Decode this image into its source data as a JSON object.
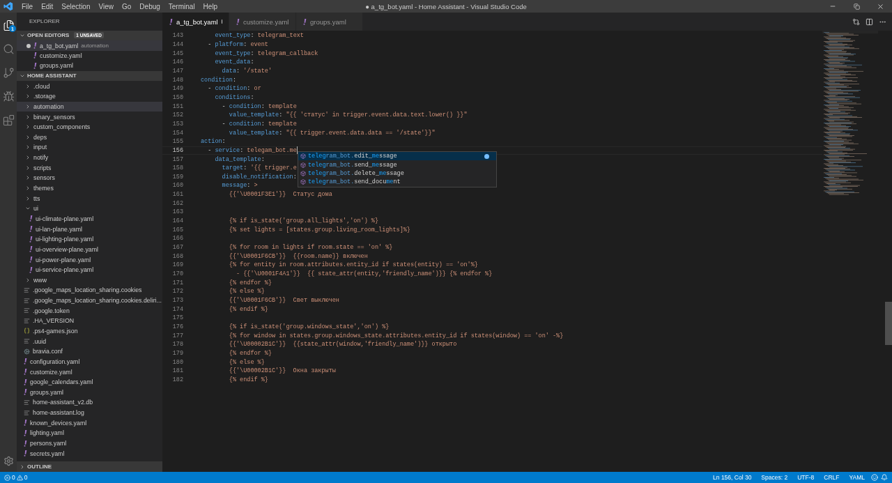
{
  "menu": [
    "File",
    "Edit",
    "Selection",
    "View",
    "Go",
    "Debug",
    "Terminal",
    "Help"
  ],
  "window": {
    "title": "● a_tg_bot.yaml - Home Assistant - Visual Studio Code"
  },
  "activity": [
    {
      "kind": "files",
      "selected": true,
      "badge": "1"
    },
    {
      "kind": "search",
      "selected": false
    },
    {
      "kind": "git",
      "selected": false
    },
    {
      "kind": "debug",
      "selected": false
    },
    {
      "kind": "extensions",
      "selected": false
    }
  ],
  "explorer": {
    "title": "EXPLORER",
    "open_editors": {
      "title": "OPEN EDITORS",
      "badge": "1 UNSAVED",
      "expanded": true,
      "items": [
        {
          "name": "a_tg_bot.yaml",
          "hint": "automation",
          "dirty": true,
          "selected": true
        },
        {
          "name": "customize.yaml",
          "dirty": false,
          "selected": false
        },
        {
          "name": "groups.yaml",
          "dirty": false,
          "selected": false
        }
      ]
    },
    "folder": {
      "title": "HOME ASSISTANT",
      "expanded": true,
      "items": [
        {
          "name": ".cloud",
          "kind": "folder",
          "expanded": false,
          "selected": false
        },
        {
          "name": ".storage",
          "kind": "folder",
          "expanded": false,
          "selected": false
        },
        {
          "name": "automation",
          "kind": "folder",
          "expanded": false,
          "selected": true
        },
        {
          "name": "binary_sensors",
          "kind": "folder",
          "expanded": false,
          "selected": false
        },
        {
          "name": "custom_components",
          "kind": "folder",
          "expanded": false,
          "selected": false
        },
        {
          "name": "deps",
          "kind": "folder",
          "expanded": false,
          "selected": false
        },
        {
          "name": "input",
          "kind": "folder",
          "expanded": false,
          "selected": false
        },
        {
          "name": "notify",
          "kind": "folder",
          "expanded": false,
          "selected": false
        },
        {
          "name": "scripts",
          "kind": "folder",
          "expanded": false,
          "selected": false
        },
        {
          "name": "sensors",
          "kind": "folder",
          "expanded": false,
          "selected": false
        },
        {
          "name": "themes",
          "kind": "folder",
          "expanded": false,
          "selected": false
        },
        {
          "name": "tts",
          "kind": "folder",
          "expanded": false,
          "selected": false
        },
        {
          "name": "ui",
          "kind": "folder",
          "expanded": true,
          "selected": false,
          "children": [
            {
              "name": "ui-climate-plane.yaml",
              "kind": "yaml",
              "selected": false
            },
            {
              "name": "ui-lan-plane.yaml",
              "kind": "yaml",
              "selected": false
            },
            {
              "name": "ui-lighting-plane.yaml",
              "kind": "yaml",
              "selected": false
            },
            {
              "name": "ui-overview-plane.yaml",
              "kind": "yaml",
              "selected": false
            },
            {
              "name": "ui-power-plane.yaml",
              "kind": "yaml",
              "selected": false
            },
            {
              "name": "ui-service-plane.yaml",
              "kind": "yaml",
              "selected": false
            }
          ]
        },
        {
          "name": "www",
          "kind": "folder",
          "expanded": false,
          "selected": false
        },
        {
          "name": ".google_maps_location_sharing.cookies",
          "kind": "file",
          "selected": false
        },
        {
          "name": ".google_maps_location_sharing.cookies.deliri...",
          "kind": "file",
          "selected": false
        },
        {
          "name": ".google.token",
          "kind": "file",
          "selected": false
        },
        {
          "name": ".HA_VERSION",
          "kind": "file",
          "selected": false
        },
        {
          "name": ".ps4-games.json",
          "kind": "json",
          "selected": false
        },
        {
          "name": ".uuid",
          "kind": "file",
          "selected": false
        },
        {
          "name": "bravia.conf",
          "kind": "config",
          "selected": false
        },
        {
          "name": "configuration.yaml",
          "kind": "yaml",
          "selected": false
        },
        {
          "name": "customize.yaml",
          "kind": "yaml",
          "selected": false
        },
        {
          "name": "google_calendars.yaml",
          "kind": "yaml",
          "selected": false
        },
        {
          "name": "groups.yaml",
          "kind": "yaml",
          "selected": false
        },
        {
          "name": "home-assistant_v2.db",
          "kind": "file",
          "selected": false
        },
        {
          "name": "home-assistant.log",
          "kind": "file",
          "selected": false
        },
        {
          "name": "known_devices.yaml",
          "kind": "yaml",
          "selected": false
        },
        {
          "name": "lighting.yaml",
          "kind": "yaml",
          "selected": false
        },
        {
          "name": "persons.yaml",
          "kind": "yaml",
          "selected": false
        },
        {
          "name": "secrets.yaml",
          "kind": "yaml",
          "selected": false
        }
      ]
    },
    "outline": {
      "title": "OUTLINE",
      "expanded": false
    }
  },
  "tabs": [
    {
      "label": "a_tg_bot.yaml",
      "dirty": true,
      "selected": true
    },
    {
      "label": "customize.yaml",
      "selected": false
    },
    {
      "label": "groups.yaml",
      "selected": false
    }
  ],
  "code": [
    {
      "number": "143",
      "active": false,
      "tokens": [
        {
          "kind": "key",
          "text": "    event_type"
        },
        {
          "kind": "punct",
          "text": ": "
        },
        {
          "kind": "value",
          "text": "telegram_text"
        }
      ]
    },
    {
      "number": "144",
      "active": false,
      "tokens": [
        {
          "kind": "punct",
          "text": "  - "
        },
        {
          "kind": "key",
          "text": "platform"
        },
        {
          "kind": "punct",
          "text": ": "
        },
        {
          "kind": "value",
          "text": "event"
        }
      ]
    },
    {
      "number": "145",
      "active": false,
      "tokens": [
        {
          "kind": "key",
          "text": "    event_type"
        },
        {
          "kind": "punct",
          "text": ": "
        },
        {
          "kind": "value",
          "text": "telegram_callback"
        }
      ]
    },
    {
      "number": "146",
      "active": false,
      "tokens": [
        {
          "kind": "key",
          "text": "    event_data"
        },
        {
          "kind": "punct",
          "text": ":"
        }
      ]
    },
    {
      "number": "147",
      "active": false,
      "tokens": [
        {
          "kind": "key",
          "text": "      data"
        },
        {
          "kind": "punct",
          "text": ": "
        },
        {
          "kind": "value",
          "text": "'/state'"
        }
      ]
    },
    {
      "number": "148",
      "active": false,
      "tokens": [
        {
          "kind": "key",
          "text": "condition"
        },
        {
          "kind": "punct",
          "text": ":"
        }
      ]
    },
    {
      "number": "149",
      "active": false,
      "tokens": [
        {
          "kind": "punct",
          "text": "  - "
        },
        {
          "kind": "key",
          "text": "condition"
        },
        {
          "kind": "punct",
          "text": ": "
        },
        {
          "kind": "value",
          "text": "or"
        }
      ]
    },
    {
      "number": "150",
      "active": false,
      "tokens": [
        {
          "kind": "key",
          "text": "    conditions"
        },
        {
          "kind": "punct",
          "text": ":"
        }
      ]
    },
    {
      "number": "151",
      "active": false,
      "tokens": [
        {
          "kind": "punct",
          "text": "      - "
        },
        {
          "kind": "key",
          "text": "condition"
        },
        {
          "kind": "punct",
          "text": ": "
        },
        {
          "kind": "value",
          "text": "template"
        }
      ]
    },
    {
      "number": "152",
      "active": false,
      "tokens": [
        {
          "kind": "key",
          "text": "        value_template"
        },
        {
          "kind": "punct",
          "text": ": "
        },
        {
          "kind": "value",
          "text": "\"{{ 'статус' in trigger.event.data.text.lower() }}\""
        }
      ]
    },
    {
      "number": "153",
      "active": false,
      "tokens": [
        {
          "kind": "punct",
          "text": "      - "
        },
        {
          "kind": "key",
          "text": "condition"
        },
        {
          "kind": "punct",
          "text": ": "
        },
        {
          "kind": "value",
          "text": "template"
        }
      ]
    },
    {
      "number": "154",
      "active": false,
      "tokens": [
        {
          "kind": "key",
          "text": "        value_template"
        },
        {
          "kind": "punct",
          "text": ": "
        },
        {
          "kind": "value",
          "text": "\"{{ trigger.event.data.data == '/state'}}\""
        }
      ]
    },
    {
      "number": "155",
      "active": false,
      "tokens": [
        {
          "kind": "key",
          "text": "action"
        },
        {
          "kind": "punct",
          "text": ":"
        }
      ]
    },
    {
      "number": "156",
      "active": true,
      "tokens": [
        {
          "kind": "punct",
          "text": "  - "
        },
        {
          "kind": "key",
          "text": "service"
        },
        {
          "kind": "punct",
          "text": ": "
        },
        {
          "kind": "value",
          "text": "telegam_bot.me"
        }
      ]
    },
    {
      "number": "157",
      "active": false,
      "tokens": [
        {
          "kind": "key",
          "text": "    data_template"
        },
        {
          "kind": "punct",
          "text": ":"
        }
      ]
    },
    {
      "number": "158",
      "active": false,
      "tokens": [
        {
          "kind": "key",
          "text": "      target"
        },
        {
          "kind": "punct",
          "text": ": "
        },
        {
          "kind": "value",
          "text": "'{{ trigger.e"
        }
      ]
    },
    {
      "number": "159",
      "active": false,
      "tokens": [
        {
          "kind": "key",
          "text": "      disable_notification"
        },
        {
          "kind": "punct",
          "text": ":"
        }
      ]
    },
    {
      "number": "160",
      "active": false,
      "tokens": [
        {
          "kind": "key",
          "text": "      message"
        },
        {
          "kind": "punct",
          "text": ": "
        },
        {
          "kind": "value",
          "text": ">"
        }
      ]
    },
    {
      "number": "161",
      "active": false,
      "tokens": [
        {
          "kind": "value",
          "text": "        {{'\\U0001F3E1'}}  Статус дома"
        }
      ]
    },
    {
      "number": "162",
      "active": false
    },
    {
      "number": "163",
      "active": false
    },
    {
      "number": "164",
      "active": false,
      "tokens": [
        {
          "kind": "value",
          "text": "        {% if is_state('group.all_lights','on') %}"
        }
      ]
    },
    {
      "number": "165",
      "active": false,
      "tokens": [
        {
          "kind": "value",
          "text": "        {% set lights = [states.group.living_room_lights]%}"
        }
      ]
    },
    {
      "number": "166",
      "active": false
    },
    {
      "number": "167",
      "active": false,
      "tokens": [
        {
          "kind": "value",
          "text": "        {% for room in lights if room.state == 'on' %}"
        }
      ]
    },
    {
      "number": "168",
      "active": false,
      "tokens": [
        {
          "kind": "value",
          "text": "        {{'\\U0001F6CB'}}  {{room.name}} включен"
        }
      ]
    },
    {
      "number": "169",
      "active": false,
      "tokens": [
        {
          "kind": "value",
          "text": "        {% for entity in room.attributes.entity_id if states(entity) == 'on'%}"
        }
      ]
    },
    {
      "number": "170",
      "active": false,
      "tokens": [
        {
          "kind": "value",
          "text": "          - {{'\\U0001F4A1'}}  {{ state_attr(entity,'friendly_name')}} {% endfor %}"
        }
      ]
    },
    {
      "number": "171",
      "active": false,
      "tokens": [
        {
          "kind": "value",
          "text": "        {% endfor %}"
        }
      ]
    },
    {
      "number": "172",
      "active": false,
      "tokens": [
        {
          "kind": "value",
          "text": "        {% else %}"
        }
      ]
    },
    {
      "number": "173",
      "active": false,
      "tokens": [
        {
          "kind": "value",
          "text": "        {{'\\U0001F6CB'}}  Свет выключен"
        }
      ]
    },
    {
      "number": "174",
      "active": false,
      "tokens": [
        {
          "kind": "value",
          "text": "        {% endif %}"
        }
      ]
    },
    {
      "number": "175",
      "active": false
    },
    {
      "number": "176",
      "active": false,
      "tokens": [
        {
          "kind": "value",
          "text": "        {% if is_state('group.windows_state','on') %}"
        }
      ]
    },
    {
      "number": "177",
      "active": false,
      "tokens": [
        {
          "kind": "value",
          "text": "        {% for window in states.group.windows_state.attributes.entity_id if states(window) == 'on' -%}"
        }
      ]
    },
    {
      "number": "178",
      "active": false,
      "tokens": [
        {
          "kind": "value",
          "text": "        {{'\\U00002B1C'}}  {{state_attr(window,'friendly_name')}} открыто"
        }
      ]
    },
    {
      "number": "179",
      "active": false,
      "tokens": [
        {
          "kind": "value",
          "text": "        {% endfor %}"
        }
      ]
    },
    {
      "number": "180",
      "active": false,
      "tokens": [
        {
          "kind": "value",
          "text": "        {% else %}"
        }
      ]
    },
    {
      "number": "181",
      "active": false,
      "tokens": [
        {
          "kind": "value",
          "text": "        {{'\\U00002B1C'}}  Окна закрыты"
        }
      ]
    },
    {
      "number": "182",
      "active": false,
      "tokens": [
        {
          "kind": "value",
          "text": "        {% endif %}"
        }
      ]
    }
  ],
  "suggestions": [
    {
      "selected": true,
      "parts": [
        {
          "kind": "match",
          "text": "teleg"
        },
        {
          "kind": "ns",
          "text": "ram_bot."
        },
        {
          "kind": "name",
          "text": "edit_"
        },
        {
          "kind": "match",
          "text": "me"
        },
        {
          "kind": "name",
          "text": "ssage"
        }
      ]
    },
    {
      "selected": false,
      "parts": [
        {
          "kind": "match",
          "text": "teleg"
        },
        {
          "kind": "ns",
          "text": "ram_bot."
        },
        {
          "kind": "name",
          "text": "send_"
        },
        {
          "kind": "match",
          "text": "me"
        },
        {
          "kind": "name",
          "text": "ssage"
        }
      ]
    },
    {
      "selected": false,
      "parts": [
        {
          "kind": "match",
          "text": "teleg"
        },
        {
          "kind": "ns",
          "text": "ram_bot."
        },
        {
          "kind": "name",
          "text": "delete_"
        },
        {
          "kind": "match",
          "text": "me"
        },
        {
          "kind": "name",
          "text": "ssage"
        }
      ]
    },
    {
      "selected": false,
      "parts": [
        {
          "kind": "match",
          "text": "teleg"
        },
        {
          "kind": "ns",
          "text": "ram_bot."
        },
        {
          "kind": "name",
          "text": "send_docu"
        },
        {
          "kind": "match",
          "text": "me"
        },
        {
          "kind": "name",
          "text": "nt"
        }
      ]
    }
  ],
  "status_bar": {
    "errors": "0",
    "warnings": "0",
    "items": [
      "Ln 156, Col 30",
      "Spaces: 2",
      "UTF-8",
      "CRLF",
      "YAML"
    ]
  }
}
